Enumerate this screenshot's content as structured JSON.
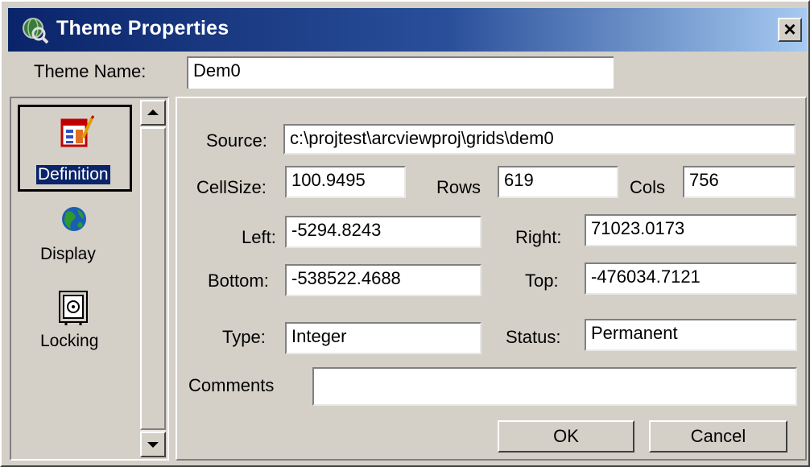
{
  "window": {
    "title": "Theme Properties",
    "icon": "arcview-theme-icon",
    "close_label": "×"
  },
  "theme_name": {
    "label": "Theme Name:",
    "value": "Dem0"
  },
  "sidebar": {
    "items": [
      {
        "label": "Definition",
        "icon": "definition-icon",
        "selected": true
      },
      {
        "label": "Display",
        "icon": "globe-icon",
        "selected": false
      },
      {
        "label": "Locking",
        "icon": "safe-lock-icon",
        "selected": false
      }
    ]
  },
  "definition": {
    "source_label": "Source:",
    "source_value": "c:\\projtest\\arcviewproj\\grids\\dem0",
    "cellsize_label": "CellSize:",
    "cellsize_value": "100.9495",
    "rows_label": "Rows",
    "rows_value": "619",
    "cols_label": "Cols",
    "cols_value": "756",
    "left_label": "Left:",
    "left_value": "-5294.8243",
    "right_label": "Right:",
    "right_value": "71023.0173",
    "bottom_label": "Bottom:",
    "bottom_value": "-538522.4688",
    "top_label": "Top:",
    "top_value": "-476034.7121",
    "type_label": "Type:",
    "type_value": "Integer",
    "status_label": "Status:",
    "status_value": "Permanent",
    "comments_label": "Comments",
    "comments_value": ""
  },
  "buttons": {
    "ok": "OK",
    "cancel": "Cancel"
  },
  "colors": {
    "titlebar_start": "#0a246a",
    "titlebar_end": "#a6caf0",
    "face": "#d4d0c8",
    "selection": "#0a246a"
  }
}
